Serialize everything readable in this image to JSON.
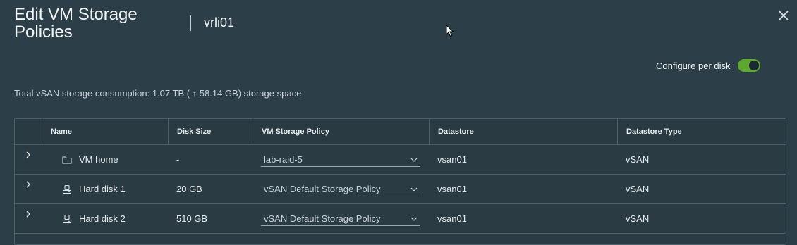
{
  "dialog": {
    "title": "Edit VM Storage Policies",
    "vm_name": "vrli01",
    "configure_per_disk_label": "Configure per disk",
    "configure_per_disk_on": true,
    "consumption_text": "Total vSAN storage consumption: 1.07 TB ( ↑ 58.14 GB) storage space"
  },
  "grid": {
    "columns": [
      "Name",
      "Disk Size",
      "VM Storage Policy",
      "Datastore",
      "Datastore Type"
    ],
    "rows": [
      {
        "icon": "folder-icon",
        "name": "VM home",
        "size": "-",
        "policy": "lab-raid-5",
        "datastore": "vsan01",
        "type": "vSAN"
      },
      {
        "icon": "hard-disk-icon",
        "name": "Hard disk 1",
        "size": "20 GB",
        "policy": "vSAN Default Storage Policy",
        "datastore": "vsan01",
        "type": "vSAN"
      },
      {
        "icon": "hard-disk-icon",
        "name": "Hard disk 2",
        "size": "510 GB",
        "policy": "vSAN Default Storage Policy",
        "datastore": "vsan01",
        "type": "vSAN"
      }
    ]
  },
  "colors": {
    "background": "#2c3e47",
    "toggle_on": "#5ea82f"
  }
}
